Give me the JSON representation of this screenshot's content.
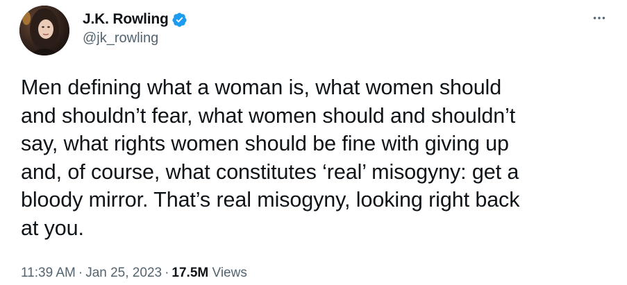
{
  "tweet": {
    "author": {
      "display_name": "J.K. Rowling",
      "handle": "@jk_rowling",
      "verified": true,
      "verified_color": "#1d9bf0"
    },
    "more_icon": "more-horizontal-icon",
    "text": "Men defining what a woman is, what women should\nand shouldn’t fear, what women should and shouldn’t\nsay, what rights women should be fine with giving up\nand, of course, what constitutes ‘real’ misogyny: get a\nbloody mirror. That’s real misogyny, looking right back\nat you.",
    "time": "11:39 AM",
    "date": "Jan 25, 2023",
    "separator": "·",
    "views_count": "17.5M",
    "views_label": "Views"
  }
}
